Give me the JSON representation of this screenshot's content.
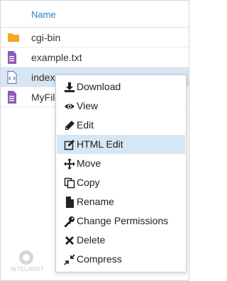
{
  "table": {
    "column_name": "Name"
  },
  "files": [
    {
      "name": "cgi-bin",
      "icon": "folder-icon"
    },
    {
      "name": "example.txt",
      "icon": "text-file-icon"
    },
    {
      "name": "index.",
      "icon": "code-file-icon",
      "selected": true
    },
    {
      "name": "MyFile",
      "icon": "text-file-icon"
    }
  ],
  "context_menu": [
    {
      "label": "Download",
      "icon": "download-icon"
    },
    {
      "label": "View",
      "icon": "eye-icon"
    },
    {
      "label": "Edit",
      "icon": "pencil-icon"
    },
    {
      "label": "HTML Edit",
      "icon": "html-edit-icon",
      "highlighted": true
    },
    {
      "label": "Move",
      "icon": "move-arrows-icon"
    },
    {
      "label": "Copy",
      "icon": "copy-icon"
    },
    {
      "label": "Rename",
      "icon": "file-icon"
    },
    {
      "label": "Change Permissions",
      "icon": "key-icon"
    },
    {
      "label": "Delete",
      "icon": "x-icon"
    },
    {
      "label": "Compress",
      "icon": "compress-icon"
    }
  ],
  "watermark": {
    "text": "INTELHOST"
  },
  "colors": {
    "accent": "#2a7dc8",
    "folder": "#f5a623",
    "file": "#8d5ab8",
    "selection": "#d7e6f3"
  }
}
